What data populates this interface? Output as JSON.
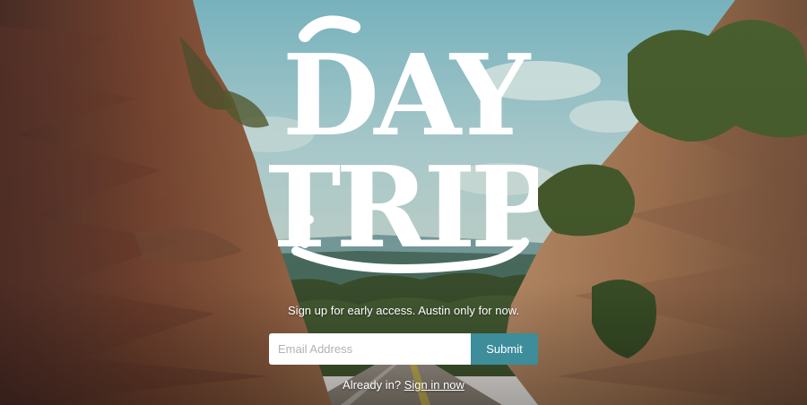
{
  "logo": {
    "line1": "DAY",
    "line2": "TRIP"
  },
  "tagline": "Sign up for early access. Austin only for now.",
  "form": {
    "email_placeholder": "Email Address",
    "submit_label": "Submit"
  },
  "signin": {
    "prompt": "Already in?",
    "link_label": "Sign in now"
  },
  "colors": {
    "accent": "#3d8d9b",
    "sky": "#8fc3cf",
    "rock": "#7a4a38"
  }
}
